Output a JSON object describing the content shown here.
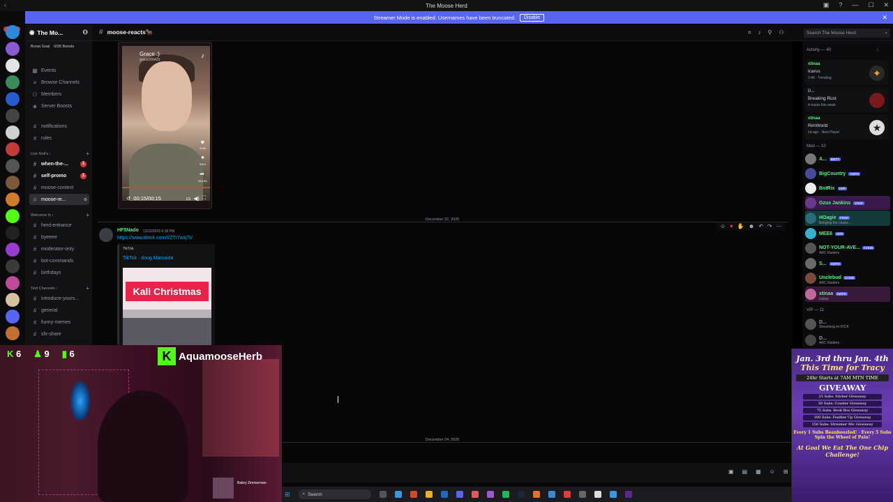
{
  "window": {
    "title": "The Moose Herd"
  },
  "banner": {
    "text": "Streamer Mode is enabled. Usernames have been truncated.",
    "button": "Disable",
    "close": "✕"
  },
  "rail": {
    "new_label": "NEW"
  },
  "guild": {
    "name": "The Mo...",
    "boost_goal": "Boost Goal",
    "boosts": "0/28 Boosts"
  },
  "nav": {
    "events": "Events",
    "browse": "Browse Channels",
    "members": "Members",
    "server_boosts": "Server Boosts"
  },
  "channels": {
    "top": [
      {
        "label": "notifications"
      },
      {
        "label": "rules"
      }
    ],
    "live_cat": "Live Noti's",
    "live": [
      {
        "label": "when-the-...",
        "badge": "1"
      },
      {
        "label": "self-promo",
        "badge": "1"
      },
      {
        "label": "moose-content"
      },
      {
        "label": "moose-re..."
      }
    ],
    "welcome_cat": "Welcome In",
    "welcome": [
      {
        "label": "herd-entrance"
      },
      {
        "label": "byeeee"
      },
      {
        "label": "moderator-only"
      },
      {
        "label": "bot-commands"
      },
      {
        "label": "birthdays"
      }
    ],
    "text_cat": "Text Channels",
    "text": [
      {
        "label": "introduce-yours..."
      },
      {
        "label": "general"
      },
      {
        "label": "funny-memes"
      },
      {
        "label": "sfx-share"
      }
    ]
  },
  "header": {
    "channel": "moose-reacts🐂",
    "search_placeholder": "Search The Moose Herd"
  },
  "tiktok1": {
    "name": "Grace :)",
    "user": "grace200423",
    "likes": "3.6M",
    "comments": "9914",
    "shares": "618.6K",
    "time": "00:15/00:15"
  },
  "dividers": {
    "d1": "December 22, 2025",
    "d2": "December 24, 2025"
  },
  "message": {
    "author": "HF5Nado",
    "timestamp": "12/22/2025 6:18 PM",
    "link": "https://www.tiktok.com/t/ZTr7wxjTr/",
    "embed_provider": "TikTok",
    "embed_title": "TikTok · doug Marcaida",
    "thumb_text": "Kali Christmas"
  },
  "activity": {
    "header": "Activity — 40",
    "items": [
      {
        "name": "xtinaa",
        "game": "Icarus",
        "status": "2:46 · Trending"
      },
      {
        "name": "D...",
        "game": "Breaking Rust",
        "status": "4 tracks this week"
      },
      {
        "name": "xtinaa",
        "game": "RimWorld",
        "status": "1d ago · New Player"
      }
    ]
  },
  "mods": {
    "header": "Mod — 10",
    "list": [
      {
        "name": "A...",
        "tag": "BNTY",
        "sub": ""
      },
      {
        "name": "BigCountry",
        "tag": "AWPS",
        "sub": ""
      },
      {
        "name": "BotRix",
        "tag": "APP",
        "sub": ""
      },
      {
        "name": "Gzus Jankins",
        "tag": "JANK",
        "sub": ""
      },
      {
        "name": "HOagie",
        "tag": "FRSH",
        "sub": "Bringing the chaos..."
      },
      {
        "name": "MEE6",
        "tag": "APP",
        "sub": ""
      },
      {
        "name": "NOT-YOUR-AVE...",
        "tag": "CHUB",
        "sub": "ARC Raiders"
      },
      {
        "name": "S...",
        "tag": "AWPS",
        "sub": ""
      },
      {
        "name": "Unclebud",
        "tag": "CHUB",
        "sub": "ARC Raiders"
      },
      {
        "name": "xtinaa",
        "tag": "AWPS",
        "sub": "Icarus"
      }
    ]
  },
  "vip": {
    "header": "VIP — 11",
    "list": [
      {
        "name": "D...",
        "sub": "Streaming on KICK"
      },
      {
        "name": "D...",
        "sub": "ARC Raiders"
      }
    ]
  },
  "overlay": {
    "kick_k": "K",
    "count1": "6",
    "count2": "9",
    "count3": "6",
    "kick_name": "AquamooseHerb",
    "np_artist": "Bailey Zimmerman"
  },
  "taskbar": {
    "search": "Search"
  },
  "promo": {
    "line1": "Jan. 3rd thru Jan. 4th",
    "line2": "This Time for Tracy",
    "line3": "24hr Starts at 7AM MTN TIME",
    "line4": "GIVEAWAY",
    "items": [
      "25 Subs: Sticker Giveaway",
      "50 Subs: Coaster Giveaway",
      "75 Subs: Book Box Giveaway",
      "100 Subs: Feather Up Giveaway",
      "150 Subs: Streamer Mic Giveaway"
    ],
    "line5": "Every 1 Subs Beanboozled! · Every 5 Subs Spin the Wheel of Pain!",
    "line6": "At Goal We Eat The One Chip Challenge!"
  },
  "colors": {
    "accent": "#5865f2",
    "online": "#57f287",
    "link": "#00a8fc",
    "kick": "#53fc18"
  }
}
